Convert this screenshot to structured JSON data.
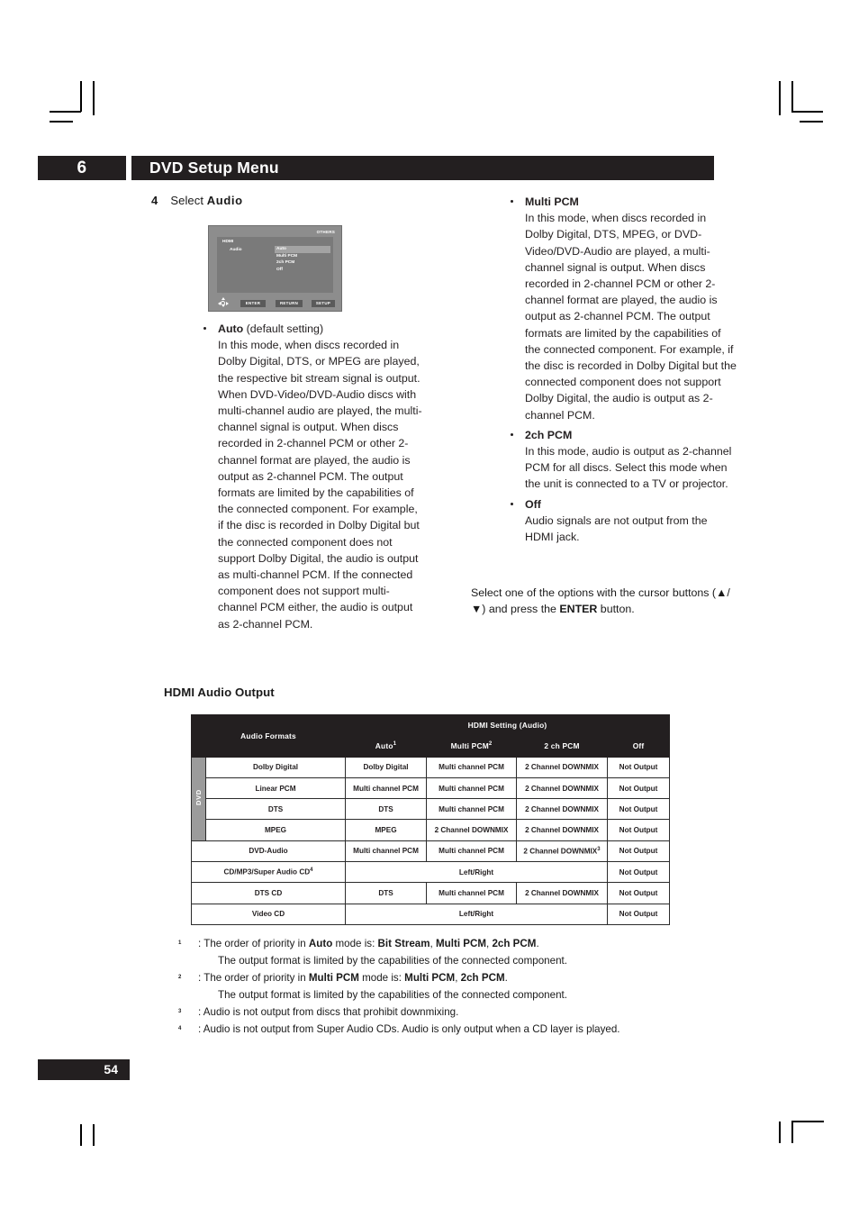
{
  "header": {
    "chapter_number": "6",
    "title": "DVD Setup Menu"
  },
  "step": {
    "number": "4",
    "lead": "Select ",
    "value": "Audio"
  },
  "osd": {
    "corner_label": "OTHERS",
    "menu_label": "HDMI",
    "sub_label": "Audio",
    "options": [
      "Auto",
      "Multi PCM",
      "2ch PCM",
      "Off"
    ],
    "selected_option": "Auto",
    "buttons": [
      "ENTER",
      "RETURN",
      "SETUP"
    ]
  },
  "left_column": {
    "items": [
      {
        "title": "Auto",
        "title_suffix": " (default setting)",
        "body": "In this mode, when discs recorded in Dolby Digital, DTS, or MPEG are played, the respective bit stream signal is output. When DVD-Video/DVD-Audio discs with multi-channel audio are played, the multi-channel signal is output. When discs recorded in 2-channel PCM or other 2-channel format are played, the audio is output as 2-channel PCM. The output formats are limited by the capabilities of the connected component. For example, if the disc is recorded in Dolby Digital but the connected component does not support Dolby Digital, the audio is output as multi-channel PCM. If the connected component does not support multi-channel PCM either, the audio is output as 2-channel PCM."
      }
    ]
  },
  "right_column": {
    "items": [
      {
        "title": "Multi PCM",
        "title_suffix": "",
        "body": "In this mode, when discs recorded in Dolby Digital, DTS, MPEG, or DVD-Video/DVD-Audio are played, a multi-channel signal is output. When discs recorded in 2-channel PCM or other 2-channel format are played, the audio is output as 2-channel PCM. The output formats are limited by the capabilities of the connected component. For example, if the disc is recorded in Dolby Digital but the connected component does not support Dolby Digital, the audio is output as 2-channel PCM."
      },
      {
        "title": "2ch PCM",
        "title_suffix": "",
        "body": "In this mode, audio is output as 2-channel PCM for all discs. Select this mode when the unit is connected to a TV or projector."
      },
      {
        "title": "Off",
        "title_suffix": "",
        "body": "Audio signals are not output from the HDMI jack."
      }
    ],
    "closing_note_part1": "Select one of the options with the cursor buttons (",
    "closing_note_arrows": "▲/▼",
    "closing_note_part2": ") and press the  ",
    "closing_note_bold": "ENTER",
    "closing_note_part3": " button."
  },
  "table_section": {
    "title": "HDMI Audio Output",
    "group_header": "HDMI Setting (Audio)",
    "format_header": "Audio Formats",
    "columns": [
      "Auto*1",
      "Multi PCM*2",
      "2 ch PCM",
      "Off"
    ],
    "group_label_dvd": "DVD",
    "rows": [
      {
        "format": "Dolby Digital",
        "cells": [
          "Dolby Digital",
          "Multi channel PCM",
          "2 Channel DOWNMIX",
          "Not Output"
        ]
      },
      {
        "format": "Linear PCM",
        "cells": [
          "Multi channel PCM",
          "Multi channel PCM",
          "2 Channel DOWNMIX",
          "Not Output"
        ]
      },
      {
        "format": "DTS",
        "cells": [
          "DTS",
          "Multi channel PCM",
          "2 Channel DOWNMIX",
          "Not Output"
        ]
      },
      {
        "format": "MPEG",
        "cells": [
          "MPEG",
          "2 Channel DOWNMIX",
          "2 Channel DOWNMIX",
          "Not Output"
        ]
      },
      {
        "format": "DVD-Audio",
        "cells": [
          "Multi channel PCM",
          "Multi channel PCM",
          "2 Channel DOWNMIX*3",
          "Not Output"
        ]
      },
      {
        "format": "CD/MP3/Super Audio CD*4",
        "cells": [
          "Left/Right",
          "Not Output"
        ]
      },
      {
        "format": "DTS CD",
        "cells": [
          "DTS",
          "Multi channel PCM",
          "2 Channel DOWNMIX",
          "Not Output"
        ]
      },
      {
        "format": "Video CD",
        "cells": [
          "Left/Right",
          "Not Output"
        ]
      }
    ]
  },
  "footnotes": [
    {
      "mark": "*1",
      "line1_a": ": The order of priority in ",
      "line1_b1": "Auto",
      "line1_c": " mode is: ",
      "line1_b2": "Bit Stream",
      "line1_d": ", ",
      "line1_b3": "Multi PCM",
      "line1_e": ", ",
      "line1_b4": "2ch PCM",
      "line1_f": ".",
      "line2": "The output format is limited by the capabilities of the connected component."
    },
    {
      "mark": "*2",
      "line1_a": ": The order of priority in ",
      "line1_b1": "Multi PCM",
      "line1_c": " mode is: ",
      "line1_b2": "Multi PCM",
      "line1_d": ", ",
      "line1_b3": "2ch PCM",
      "line1_e": ".",
      "line2": "The output format is limited by the capabilities of the connected component."
    },
    {
      "mark": "*3",
      "line1_a": ": Audio is not output from discs that prohibit downmixing.",
      "line2": ""
    },
    {
      "mark": "*4",
      "line1_a": ": Audio is not output from Super Audio CDs. Audio is only output when a CD layer is played.",
      "line2": ""
    }
  ],
  "page_number": "54"
}
